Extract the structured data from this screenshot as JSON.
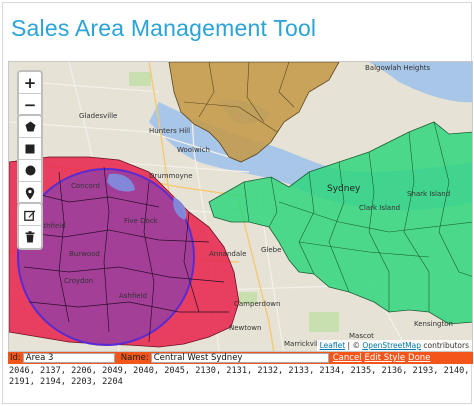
{
  "app": {
    "title": "Sales Area Management Tool"
  },
  "map_labels": {
    "balgowlah_heights": "Balgowlah Heights",
    "sydney": "Sydney",
    "five_dock": "Five Dock",
    "concord": "Concord",
    "annandale": "Annandale",
    "glebe": "Glebe",
    "camperdown": "Camperdown",
    "newtown": "Newtown",
    "kensington": "Kensington",
    "clark_island": "Clark Island",
    "shark_island": "Shark Island",
    "gladesville": "Gladesville",
    "hunters_hill": "Hunters Hill",
    "woolwich": "Woolwich",
    "drummoyne": "Drummoyne",
    "strathfield": "Strathfield",
    "burwood": "Burwood",
    "croydon": "Croydon",
    "ashfield": "Ashfield",
    "marrickville": "Marrickville",
    "mascot": "Mascot"
  },
  "map_controls": {
    "zoom_in": "+",
    "zoom_out": "−"
  },
  "attribution": {
    "leaflet": "Leaflet",
    "separator": " | © ",
    "osm": "OpenStreetMap",
    "suffix": " contributors"
  },
  "edit_bar": {
    "id_label": "Id:",
    "id_value": "Area 3",
    "name_label": "Name:",
    "name_value": "Central West Sydney",
    "cancel": "Cancel",
    "edit_style": "Edit Style",
    "done": "Done"
  },
  "postcodes": "2046, 2137, 2206, 2049, 2040, 2045, 2130, 2131, 2132, 2133, 2134, 2135, 2136, 2193, 2140, 2191, 2194, 2203, 2204",
  "colors": {
    "title": "#2aa3d8",
    "area_red": "#e8274f",
    "area_green": "#2fd67e",
    "area_brown": "#c49a48",
    "circle": "#6b3fc6",
    "edit_bar": "#f3551b",
    "water": "#a8c6e8"
  }
}
